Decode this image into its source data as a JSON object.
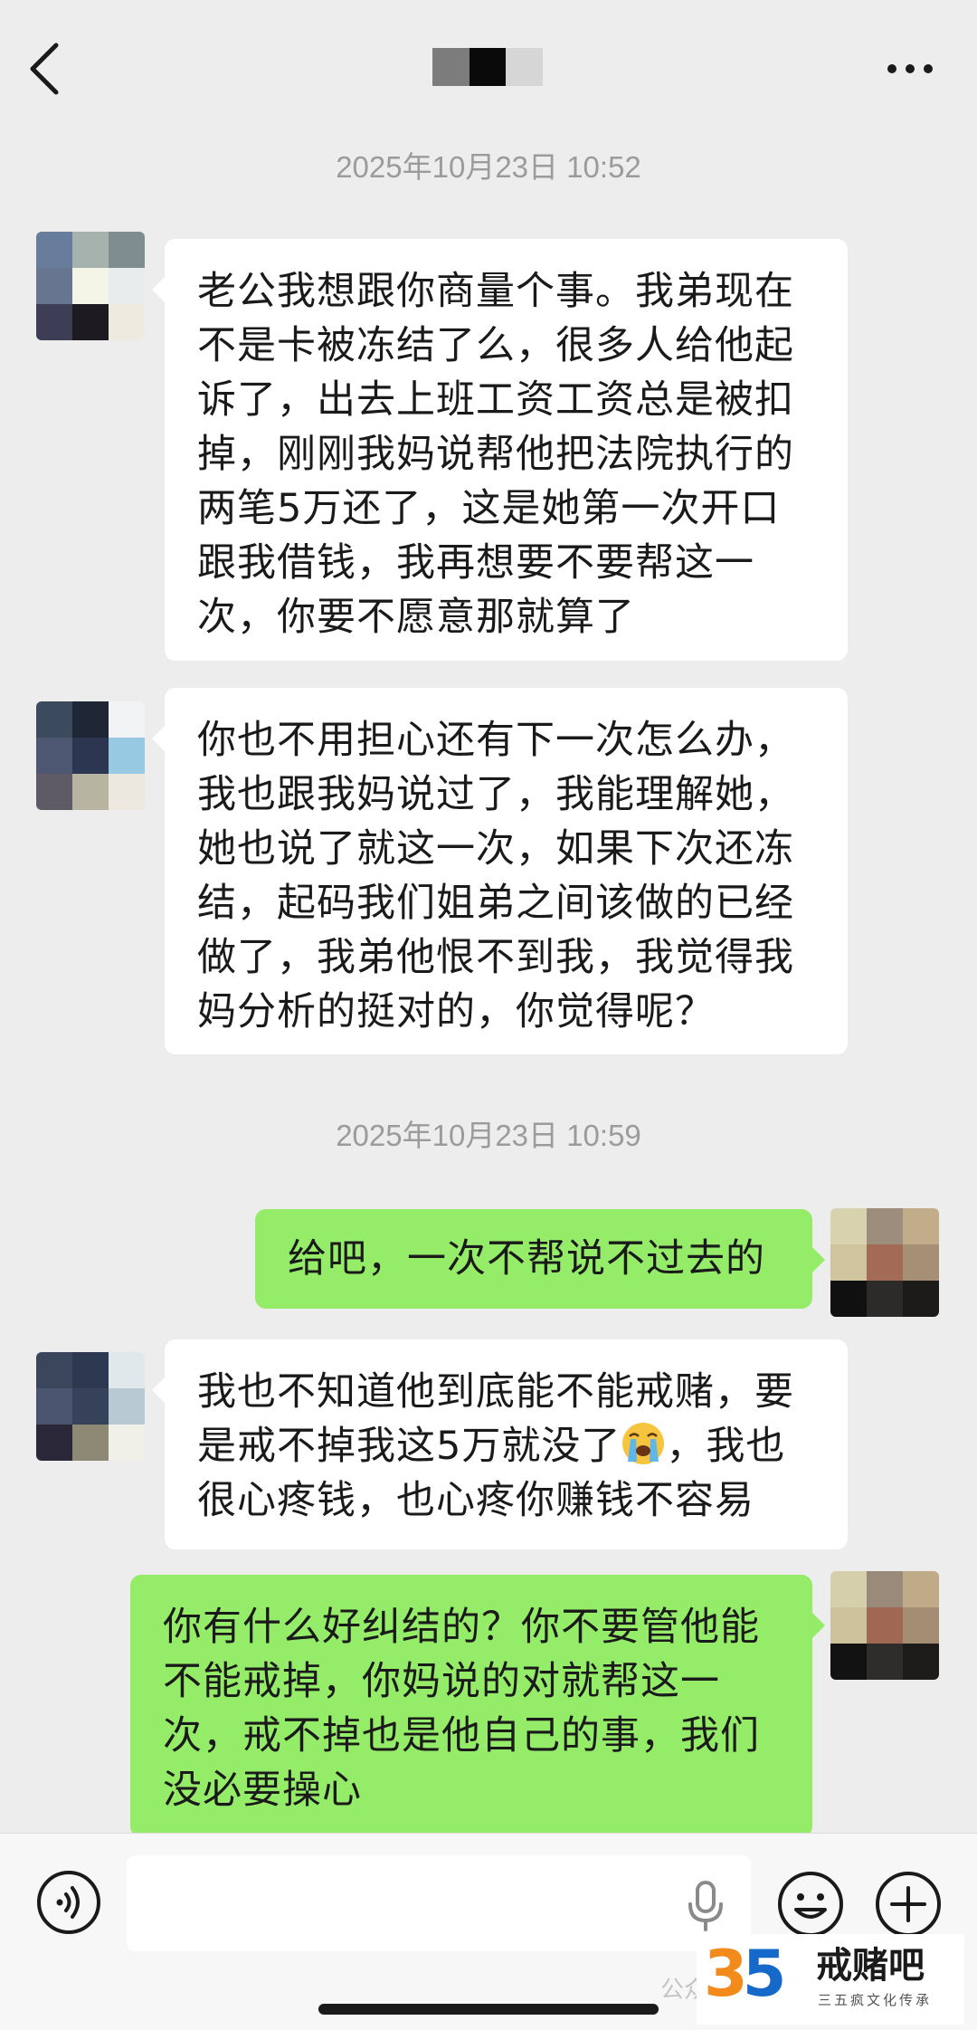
{
  "header": {
    "back_icon": "chevron-left-icon",
    "more_icon": "more-dots-icon",
    "title_mosaic_colors": [
      "#7c7c7c",
      "#0a0a0a",
      "#d6d6d6"
    ]
  },
  "chat": {
    "timestamps": [
      "2025年10月23日 10:52",
      "2025年10月23日 10:59"
    ],
    "messages": [
      {
        "side": "in",
        "lines": [
          "老公我想跟你商量个事。我弟现在",
          "不是卡被冻结了么，很多人给他起",
          "诉了，出去上班工资工资总是被扣",
          "掉，刚刚我妈说帮他把法院执行的",
          "两笔5万还了，这是她第一次开口",
          "跟我借钱，我再想要不要帮这一",
          "次，你要不愿意那就算了"
        ]
      },
      {
        "side": "in",
        "lines": [
          "你也不用担心还有下一次怎么办，",
          "我也跟我妈说过了，我能理解她，",
          "她也说了就这一次，如果下次还冻",
          "结，起码我们姐弟之间该做的已经",
          "做了，我弟他恨不到我，我觉得我",
          "妈分析的挺对的，你觉得呢？"
        ]
      },
      {
        "side": "out",
        "lines": [
          "给吧，一次不帮说不过去的"
        ]
      },
      {
        "side": "in",
        "lines": [
          "我也不知道他到底能不能戒赌，要",
          "是戒不掉我这5万就没了",
          "，我也",
          "很心疼钱，也心疼你赚钱不容易"
        ],
        "emoji": "loudly-crying-face-icon"
      },
      {
        "side": "out",
        "lines": [
          "你有什么好纠结的？你不要管他能",
          "不能戒掉，你妈说的对就帮这一",
          "次，戒不掉也是他自己的事，我们",
          "没必要操心"
        ]
      }
    ],
    "colors": {
      "background": "#ededed",
      "incoming_bubble": "#ffffff",
      "outgoing_bubble": "#95ec69",
      "timestamp_text": "#9b9b9b"
    }
  },
  "input_bar": {
    "value": "",
    "voice_icon": "voice-wave-icon",
    "mic_icon": "microphone-icon",
    "emoji_icon": "smiley-icon",
    "plus_icon": "plus-circle-icon"
  },
  "watermark": {
    "number": "35",
    "number_prefix": "3",
    "number_suffix": "5",
    "title": "戒赌吧",
    "subtitle": "三五疯文化传承",
    "faded_text": "公众号"
  }
}
